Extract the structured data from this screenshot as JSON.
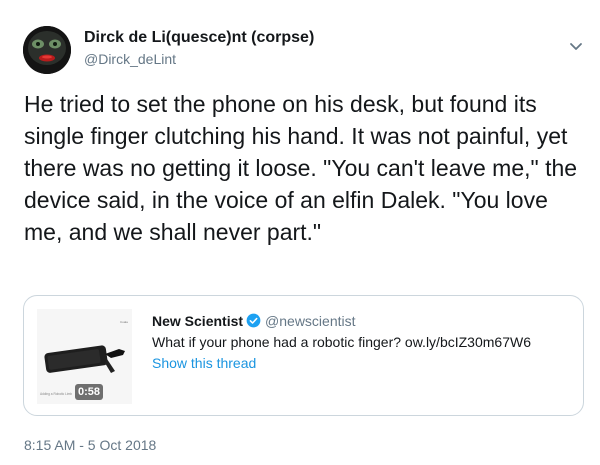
{
  "author": {
    "name": "Dirck de Li(quesce)nt (corpse)",
    "handle": "@Dirck_deLint",
    "avatar_icon": "avatar-face-icon"
  },
  "tweet": {
    "text": "He tried to set the phone on his desk, but found its single finger clutching his hand. It was not painful, yet there was no getting it loose. \"You can't leave me,\" the device said, in the voice of an elfin Dalek. \"You love me, and we shall never part.\"",
    "timestamp": "8:15 AM - 5 Oct 2018"
  },
  "quoted_tweet": {
    "name": "New Scientist",
    "handle": "@newscientist",
    "text": "What if your phone had a robotic finger? ow.ly/bcIZ30m67W6",
    "show_thread": "Show this thread",
    "video_duration": "0:58",
    "verified_icon": "verified-badge-icon"
  },
  "menu": {
    "caret_icon": "chevron-down-icon"
  },
  "colors": {
    "link": "#1b95e0",
    "secondary": "#657786",
    "text": "#14171a",
    "border": "#ccd6dd",
    "verified": "#1da1f2"
  }
}
